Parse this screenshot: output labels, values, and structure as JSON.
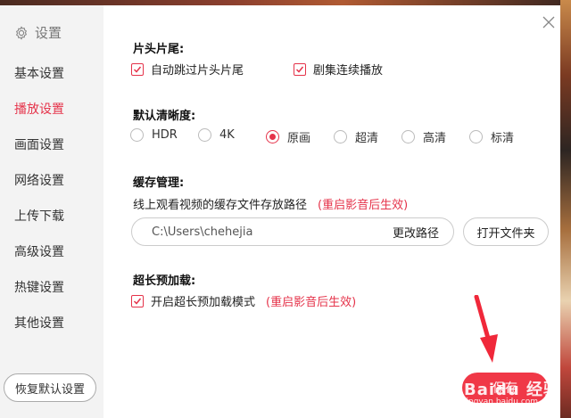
{
  "sidebar": {
    "header_label": "设置",
    "items": [
      {
        "label": "基本设置",
        "active": false
      },
      {
        "label": "播放设置",
        "active": true
      },
      {
        "label": "画面设置",
        "active": false
      },
      {
        "label": "网络设置",
        "active": false
      },
      {
        "label": "上传下载",
        "active": false
      },
      {
        "label": "高级设置",
        "active": false
      },
      {
        "label": "热键设置",
        "active": false
      },
      {
        "label": "其他设置",
        "active": false
      }
    ],
    "reset_label": "恢复默认设置"
  },
  "sections": {
    "intro_outro": {
      "title": "片头片尾:",
      "options": [
        {
          "label": "自动跳过片头片尾",
          "checked": true
        },
        {
          "label": "剧集连续播放",
          "checked": true
        }
      ]
    },
    "resolution": {
      "title": "默认清晰度:",
      "options": [
        "HDR",
        "4K",
        "原画",
        "超清",
        "高清",
        "标清"
      ],
      "selected": "原画"
    },
    "cache": {
      "title": "缓存管理:",
      "description": "线上观看视频的缓存文件存放路径",
      "note": "(重启影音后生效)",
      "path_value": "C:\\Users\\chehejia",
      "change_label": "更改路径",
      "open_label": "打开文件夹"
    },
    "preload": {
      "title": "超长预加载:",
      "option_label": "开启超长预加载模式",
      "checked": true,
      "note": "(重启影音后生效)"
    }
  },
  "footer": {
    "save_label": "保存"
  },
  "watermark": {
    "text": "Baidu 经验",
    "sub": "jingyan.baidu.com"
  },
  "colors": {
    "accent": "#e5334a",
    "save_button": "#f03847",
    "sidebar_bg": "#f3f3f3"
  }
}
